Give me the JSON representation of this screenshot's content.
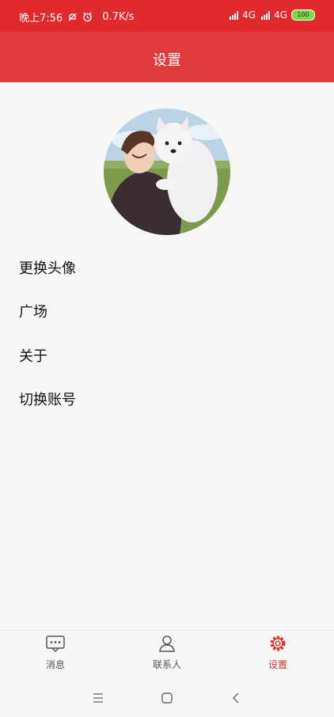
{
  "status_bar": {
    "time": "晚上7:56",
    "speed": "0.7K/s",
    "net1": "4G",
    "net2": "4G",
    "battery": "100",
    "icons": [
      "mute-icon",
      "alarm-icon",
      "signal-icon",
      "battery-icon"
    ]
  },
  "header": {
    "title": "设置"
  },
  "menu": {
    "items": [
      {
        "label": "更换头像"
      },
      {
        "label": "广场"
      },
      {
        "label": "关于"
      },
      {
        "label": "切换账号"
      }
    ]
  },
  "tabs": [
    {
      "label": "消息",
      "icon": "message-icon"
    },
    {
      "label": "联系人",
      "icon": "contact-icon"
    },
    {
      "label": "设置",
      "icon": "settings-gear-icon",
      "active": true
    }
  ],
  "nav": {
    "icons": [
      "menu-icon",
      "home-icon",
      "back-icon"
    ]
  },
  "colors": {
    "primary": "#e33a3c",
    "status_bar": "#e02a2e",
    "background": "#f7f8f6"
  }
}
